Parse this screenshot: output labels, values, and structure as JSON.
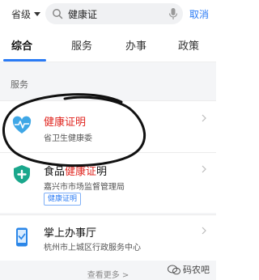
{
  "topbar": {
    "region_label": "省级",
    "search_value": "健康证",
    "cancel_label": "取消",
    "icons": {
      "region": "chevron-down-icon",
      "search": "search-icon",
      "mic": "mic-icon"
    }
  },
  "tabs": [
    {
      "label": "综合",
      "active": true
    },
    {
      "label": "服务",
      "active": false
    },
    {
      "label": "办事",
      "active": false
    },
    {
      "label": "政策",
      "active": false
    }
  ],
  "section": {
    "title": "服务"
  },
  "results": [
    {
      "title_prefix": "",
      "title_highlight": "健康证明",
      "title_suffix": "",
      "subtitle": "省卫生健康委",
      "icon": "heart-pulse-icon",
      "tag": ""
    },
    {
      "title_prefix": "食品",
      "title_highlight": "健康证",
      "title_suffix": "明",
      "subtitle": "嘉兴市市场监督管理局",
      "icon": "shield-plus-icon",
      "tag": "健康证明"
    },
    {
      "title_prefix": "掌上办事厅",
      "title_highlight": "",
      "title_suffix": "",
      "subtitle": "杭州市上城区行政服务中心",
      "icon": "phone-check-icon",
      "tag": ""
    }
  ],
  "footer": {
    "more_label": "查看更多 >",
    "watermark": "码农吧"
  },
  "colors": {
    "accent": "#2a7bf5",
    "highlight": "#e0251f"
  }
}
